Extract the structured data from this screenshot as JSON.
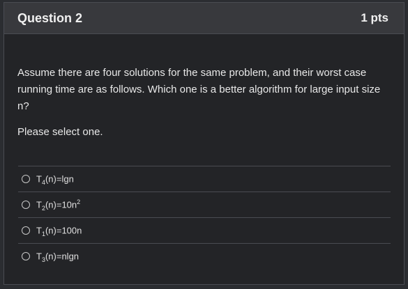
{
  "question": {
    "title": "Question 2",
    "points": "1 pts",
    "text": "Assume there are four solutions for the same problem, and their worst case running time are as follows. Which one is a better algorithm for large input size n?",
    "instruction": "Please select one."
  },
  "answers": [
    {
      "prefix": "T",
      "sub": "4",
      "expr": "(n)=lgn",
      "sup": ""
    },
    {
      "prefix": "T",
      "sub": "2",
      "expr": "(n)=10n",
      "sup": "2"
    },
    {
      "prefix": "T",
      "sub": "1",
      "expr": "(n)=100n",
      "sup": ""
    },
    {
      "prefix": "T",
      "sub": "3",
      "expr": "(n)=nlgn",
      "sup": ""
    }
  ]
}
